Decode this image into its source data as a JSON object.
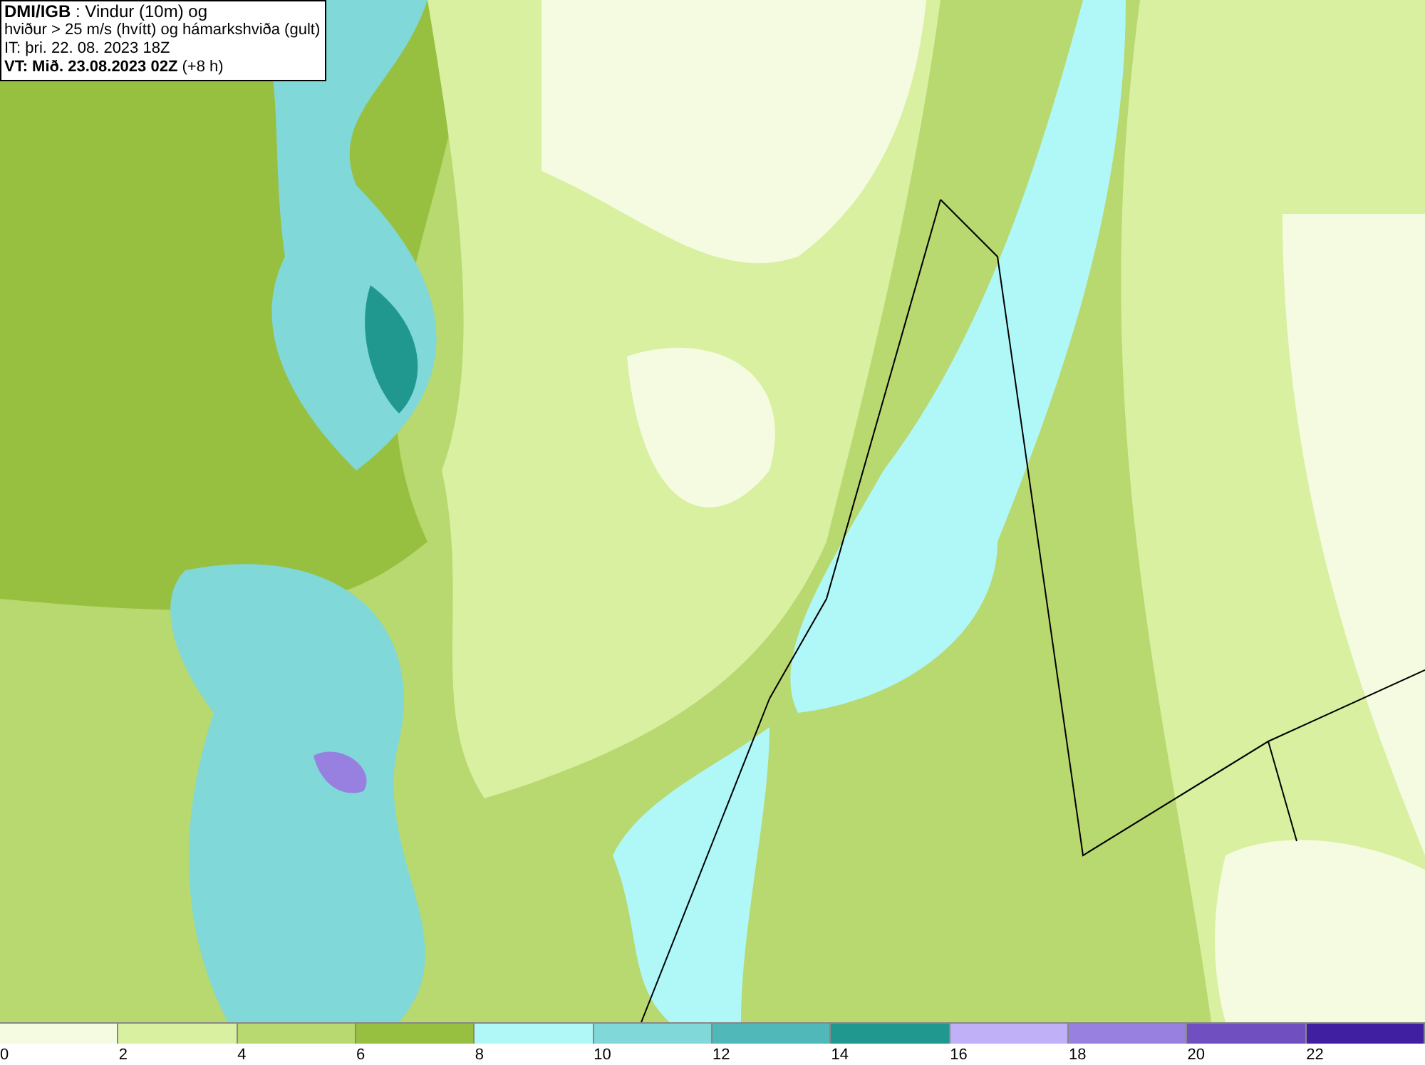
{
  "title_box": {
    "lines": [
      "**DMI/IGB** : Vindur (10m) og",
      "hviður > 25 m/s (hvítt) og hámarkshviða (gult)",
      "IT: þri. 22. 08. 2023 18Z",
      "**VT: Mið. 23.08.2023 02Z** (+8 h)"
    ]
  },
  "legend": {
    "bins": [
      {
        "color": "#f5fbe0",
        "label": "0"
      },
      {
        "color": "#d8f0a0",
        "label": "2"
      },
      {
        "color": "#b8d870",
        "label": "4"
      },
      {
        "color": "#98c040",
        "label": "6"
      },
      {
        "color": "#b0f8f8",
        "label": "8"
      },
      {
        "color": "#80d8d8",
        "label": "10"
      },
      {
        "color": "#50b8b8",
        "label": "12"
      },
      {
        "color": "#209890",
        "label": "14"
      },
      {
        "color": "#c0b0f8",
        "label": "16"
      },
      {
        "color": "#9880e0",
        "label": "18"
      },
      {
        "color": "#7050c0",
        "label": "20"
      },
      {
        "color": "#4020a0",
        "label": "22"
      }
    ]
  }
}
